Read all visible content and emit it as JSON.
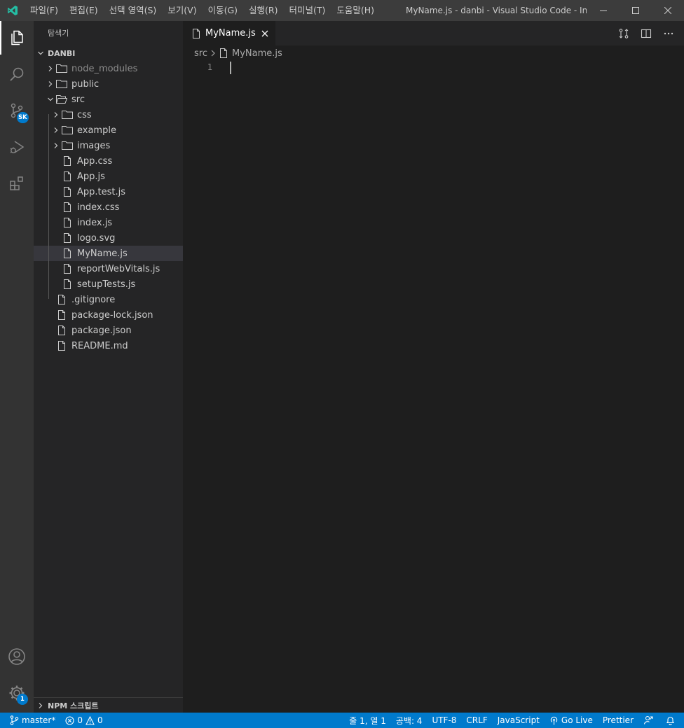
{
  "menu": [
    "파일(F)",
    "편집(E)",
    "선택 영역(S)",
    "보기(V)",
    "이동(G)",
    "실행(R)",
    "터미널(T)",
    "도움말(H)"
  ],
  "window_title": "MyName.js - danbi - Visual Studio Code - Insid...",
  "activity": {
    "scm_badge": "SK",
    "settings_badge": "1"
  },
  "sidebar": {
    "title": "탐색기",
    "section": "DANBI",
    "npm_section": "NPM 스크립트",
    "tree": [
      {
        "label": "node_modules",
        "type": "folder",
        "open": false,
        "depth": 0,
        "dim": true
      },
      {
        "label": "public",
        "type": "folder",
        "open": false,
        "depth": 0
      },
      {
        "label": "src",
        "type": "folder",
        "open": true,
        "depth": 0
      },
      {
        "label": "css",
        "type": "folder",
        "open": false,
        "depth": 1
      },
      {
        "label": "example",
        "type": "folder",
        "open": false,
        "depth": 1
      },
      {
        "label": "images",
        "type": "folder",
        "open": false,
        "depth": 1
      },
      {
        "label": "App.css",
        "type": "file",
        "depth": 1
      },
      {
        "label": "App.js",
        "type": "file",
        "depth": 1
      },
      {
        "label": "App.test.js",
        "type": "file",
        "depth": 1
      },
      {
        "label": "index.css",
        "type": "file",
        "depth": 1
      },
      {
        "label": "index.js",
        "type": "file",
        "depth": 1
      },
      {
        "label": "logo.svg",
        "type": "file",
        "depth": 1
      },
      {
        "label": "MyName.js",
        "type": "file",
        "depth": 1,
        "selected": true
      },
      {
        "label": "reportWebVitals.js",
        "type": "file",
        "depth": 1
      },
      {
        "label": "setupTests.js",
        "type": "file",
        "depth": 1
      },
      {
        "label": ".gitignore",
        "type": "file",
        "depth": 0
      },
      {
        "label": "package-lock.json",
        "type": "file",
        "depth": 0
      },
      {
        "label": "package.json",
        "type": "file",
        "depth": 0
      },
      {
        "label": "README.md",
        "type": "file",
        "depth": 0
      }
    ]
  },
  "editor": {
    "tab_label": "MyName.js",
    "breadcrumb": [
      "src",
      "MyName.js"
    ],
    "line_number": "1"
  },
  "status": {
    "branch": "master*",
    "errors": "0",
    "warnings": "0",
    "position": "줄 1, 열 1",
    "spaces": "공백: 4",
    "encoding": "UTF-8",
    "eol": "CRLF",
    "language": "JavaScript",
    "golive": "Go Live",
    "prettier": "Prettier"
  },
  "colors": {
    "accent": "#007acc",
    "logo": "#24bfa5",
    "selection": "#37373d"
  }
}
